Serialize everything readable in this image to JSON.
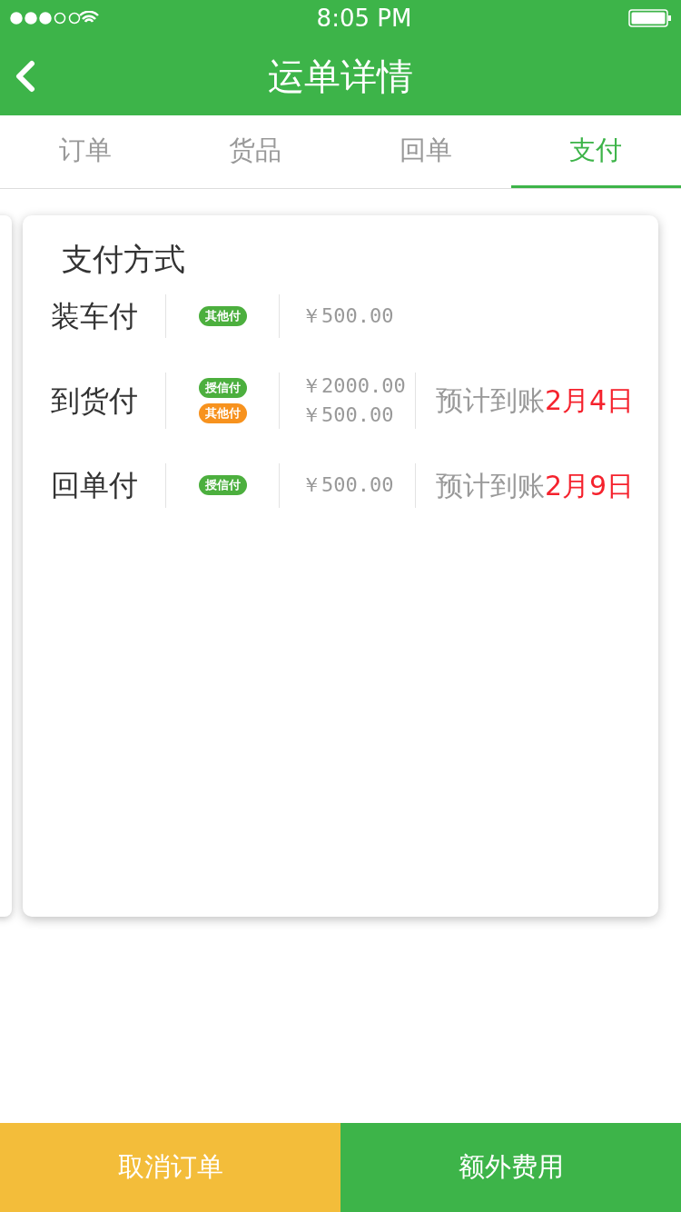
{
  "status_bar": {
    "time": "8:05 PM"
  },
  "header": {
    "title": "运单详情"
  },
  "tabs": [
    {
      "label": "订单",
      "selected": false
    },
    {
      "label": "货品",
      "selected": false
    },
    {
      "label": "回单",
      "selected": false
    },
    {
      "label": "支付",
      "selected": true
    }
  ],
  "card": {
    "title": "支付方式",
    "rows": [
      {
        "name": "装车付",
        "payments": [
          {
            "tag": "其他付",
            "color": "#4caf3e",
            "amount": "￥500.00"
          }
        ]
      },
      {
        "name": "到货付",
        "payments": [
          {
            "tag": "授信付",
            "color": "#4caf3e",
            "amount": "￥2000.00"
          },
          {
            "tag": "其他付",
            "color": "#f7921e",
            "amount": "￥500.00"
          }
        ],
        "eta_label": "预计到账",
        "eta_date": "2月4日"
      },
      {
        "name": "回单付",
        "payments": [
          {
            "tag": "授信付",
            "color": "#4caf3e",
            "amount": "￥500.00"
          }
        ],
        "eta_label": "预计到账",
        "eta_date": "2月9日"
      }
    ]
  },
  "buttons": [
    {
      "label": "取消订单",
      "kind": "warning"
    },
    {
      "label": "额外费用",
      "kind": "primary"
    }
  ]
}
